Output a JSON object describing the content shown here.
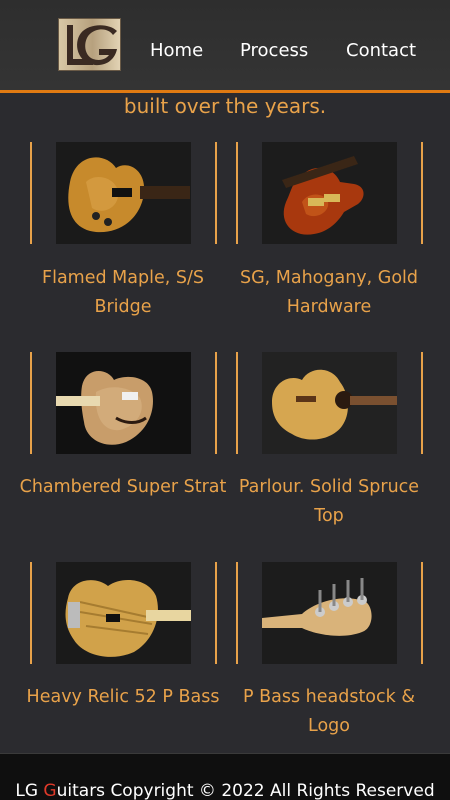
{
  "header": {
    "logo_alt": "LG Guitars logo",
    "nav": [
      "Home",
      "Process",
      "Contact"
    ]
  },
  "intro": {
    "text": "built over the years."
  },
  "gallery": [
    {
      "caption": "Flamed Maple, S/S Bridge"
    },
    {
      "caption": "SG, Mahogany, Gold Hardware"
    },
    {
      "caption": "Chambered Super Strat"
    },
    {
      "caption": "Parlour. Solid Spruce Top"
    },
    {
      "caption": "Heavy Relic 52 P Bass"
    },
    {
      "caption": "P Bass headstock & Logo"
    }
  ],
  "footer": {
    "brand_start": "LG ",
    "brand_accent": "G",
    "brand_end": "uitars Copyright © 2022 All Rights Reserved"
  },
  "colors": {
    "accent": "#e8a24a",
    "rule": "#e07a12",
    "background": "#2b2b2f"
  }
}
